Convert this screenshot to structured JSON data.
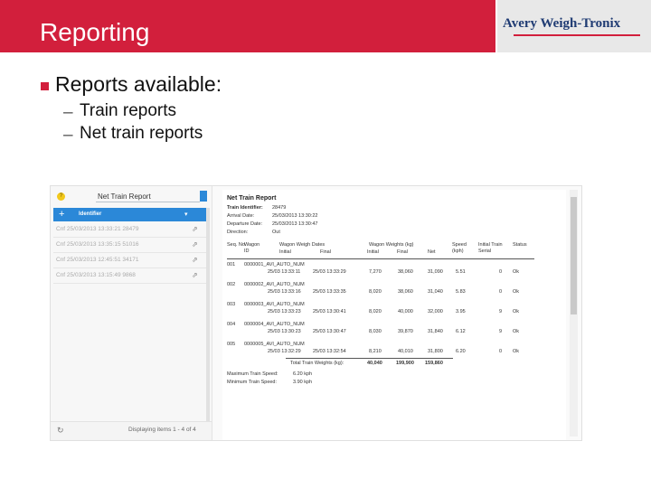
{
  "slide": {
    "title": "Reporting",
    "logo_text": "Avery Weigh-Tronix",
    "bullet": "Reports available:",
    "sub_bullets": [
      "Train reports",
      "Net train reports"
    ]
  },
  "left_panel": {
    "title": "Net Train Report",
    "column_header": "Identifier",
    "rows": [
      "Cnf  25/03/2013 13:33:21  28479",
      "Cnf  25/03/2013 13:35:15  51016",
      "Cnf  25/03/2013 12:45:51  34171",
      "Cnf  25/03/2013 13:15:49  9868"
    ],
    "footer": "Displaying items 1 - 4 of 4"
  },
  "report": {
    "title": "Net Train Report",
    "info": [
      {
        "label": "Train Identifier:",
        "value": "28479"
      },
      {
        "label": "Arrival Date:",
        "value": "25/03/2013  13:30:22"
      },
      {
        "label": "Departure Date:",
        "value": "25/03/2013  13:30:47"
      },
      {
        "label": "Direction:",
        "value": "Out"
      }
    ],
    "headers": {
      "seq": "Seq. No",
      "wagon": "Wagon ID",
      "weigh_dates": "Wagon Weigh Dates",
      "initial": "Initial",
      "final": "Final",
      "weights_group": "Wagon Weights (kg)",
      "w_initial": "Initial",
      "w_final": "Final",
      "w_net": "Net",
      "speed": "Speed (kph)",
      "serial": "Initial Train Serial",
      "status": "Status"
    },
    "rows": [
      {
        "seq": "001",
        "wagon": "0000001_AVI_AUTO_NUM",
        "initial": "25/03  13:33:11",
        "final": "25/03  13:33:29",
        "w_initial": "7,270",
        "w_final": "38,060",
        "w_net": "31,090",
        "speed": "5.51",
        "serial": "0",
        "status": "Ok"
      },
      {
        "seq": "002",
        "wagon": "0000002_AVI_AUTO_NUM",
        "initial": "25/03  13:33:16",
        "final": "25/03  13:33:35",
        "w_initial": "8,020",
        "w_final": "38,060",
        "w_net": "31,040",
        "speed": "5.83",
        "serial": "0",
        "status": "Ok"
      },
      {
        "seq": "003",
        "wagon": "0000003_AVI_AUTO_NUM",
        "initial": "25/03  13:33:23",
        "final": "25/03  13:30:41",
        "w_initial": "8,020",
        "w_final": "40,000",
        "w_net": "32,000",
        "speed": "3.95",
        "serial": "9",
        "status": "Ok"
      },
      {
        "seq": "004",
        "wagon": "0000004_AVI_AUTO_NUM",
        "initial": "25/03  13:30:23",
        "final": "25/03  13:30:47",
        "w_initial": "8,030",
        "w_final": "39,870",
        "w_net": "31,840",
        "speed": "6.12",
        "serial": "9",
        "status": "Ok"
      },
      {
        "seq": "005",
        "wagon": "0000005_AVI_AUTO_NUM",
        "initial": "25/03  13:32:29",
        "final": "25/03  13:32:54",
        "w_initial": "8,210",
        "w_final": "40,010",
        "w_net": "31,800",
        "speed": "6.20",
        "serial": "0",
        "status": "Ok"
      }
    ],
    "totals": {
      "label": "Total Train Weights (kg):",
      "initial": "40,040",
      "final": "199,900",
      "net": "159,860"
    },
    "speeds": [
      {
        "label": "Maximum Train Speed:",
        "value": "6.20 kph"
      },
      {
        "label": "Minimum Train Speed:",
        "value": "3.90 kph"
      }
    ]
  }
}
